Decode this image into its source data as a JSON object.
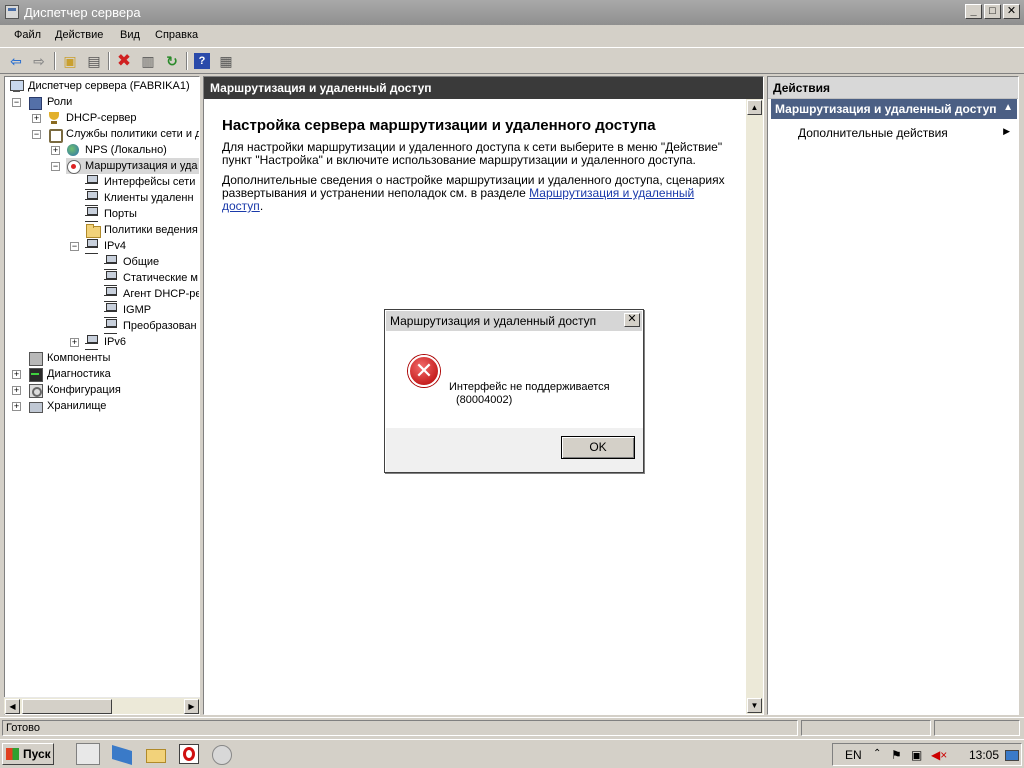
{
  "window": {
    "title": "Диспетчер сервера"
  },
  "menu": [
    "Файл",
    "Действие",
    "Вид",
    "Справка"
  ],
  "toolbar": {
    "icons": [
      "back-icon",
      "forward-icon",
      "up-folder-icon",
      "show-hide-tree-icon",
      "delete-icon",
      "properties-icon",
      "refresh-icon",
      "help-icon",
      "show-hide-action-pane-icon"
    ]
  },
  "tree": {
    "root": "Диспетчер сервера (FABRIKA1)",
    "roles": "Роли",
    "dhcp": "DHCP-сервер",
    "policy_services": "Службы политики сети и д",
    "nps": "NPS (Локально)",
    "rras": "Маршрутизация и уда",
    "interfaces": "Интерфейсы сети",
    "clients": "Клиенты удаленн",
    "ports": "Порты",
    "logging": "Политики ведения",
    "ipv4": "IPv4",
    "general": "Общие",
    "static": "Статические м",
    "dhcp_agent": "Агент DHCP-ре",
    "igmp": "IGMP",
    "nat": "Преобразован",
    "ipv6": "IPv6",
    "components": "Компоненты",
    "diagnostics": "Диагностика",
    "configuration": "Конфигурация",
    "storage": "Хранилище"
  },
  "center": {
    "header": "Маршрутизация и удаленный доступ",
    "heading": "Настройка сервера маршрутизации и удаленного доступа",
    "para1": "Для настройки маршрутизации и удаленного доступа к сети выберите в меню \"Действие\" пункт \"Настройка\" и включите использование маршрутизации и удаленного доступа.",
    "para2_text": "Дополнительные сведения о настройке маршрутизации и удаленного доступа, сценариях развертывания и устранении неполадок см. в разделе ",
    "para2_link": "Маршрутизация и удаленный доступ",
    "para2_end": "."
  },
  "dialog": {
    "title": "Маршрутизация и удаленный доступ",
    "message_line1": "Интерфейс не поддерживается",
    "message_line2": "(80004002)",
    "ok": "OK"
  },
  "actions": {
    "header": "Действия",
    "section": "Маршрутизация и удаленный доступ",
    "more": "Дополнительные действия"
  },
  "status": {
    "text": "Готово"
  },
  "taskbar": {
    "start": "Пуск",
    "lang": "EN",
    "time": "13:05"
  }
}
